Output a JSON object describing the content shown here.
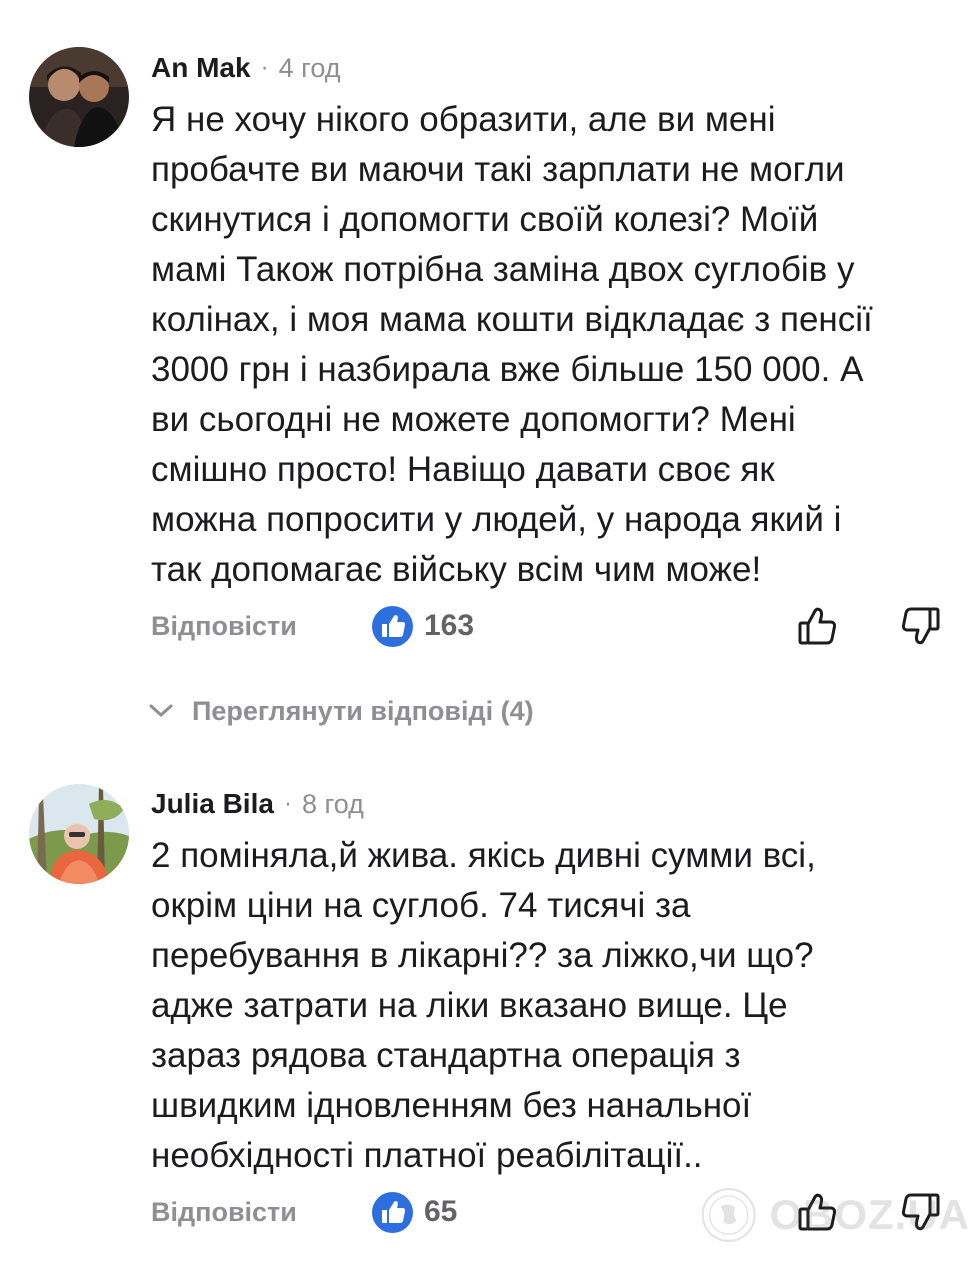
{
  "comments": [
    {
      "author": "An Mak",
      "separator": "·",
      "time": "4 год",
      "body_lines": [
        "Я не хочу нікого образити, але ви мені",
        "пробачте ви маючи такі зарплати не могли",
        "скинутися і допомогти своїй колезі? Моїй",
        "мамі Також потрібна заміна двох суглобів у",
        "колінах, і моя мама кошти відкладає з пенсії",
        "3000 грн і назбирала вже більше 150 000. А",
        "ви сьогодні не можете допомогти? Мені",
        "смішно просто! Навіщо давати своє як",
        "можна попросити у людей, у народа який і",
        "так допомагає війську всім чим може!"
      ],
      "reply_label": "Відповісти",
      "like_count": "163",
      "view_replies_label": "Переглянути відповіді (4)"
    },
    {
      "author": "Julia Bila",
      "separator": "·",
      "time": "8 год",
      "body_lines": [
        "2 поміняла,й жива. якісь дивні сумми всі,",
        "окрім ціни на суглоб. 74 тисячі за",
        "перебування в лікарні?? за ліжко,чи що?",
        "адже затрати на ліки вказано вище. Це",
        "зараз рядова стандартна операція з",
        "швидким ідновленням без нанальної",
        "необхідності платної реабілітації.."
      ],
      "reply_label": "Відповісти",
      "like_count": "65"
    }
  ],
  "watermark": {
    "text": "OBOZ.UA",
    "icon": "globe-logo-icon"
  },
  "icons": {
    "like_badge": "thumbs-up-filled-icon",
    "like_button": "thumbs-up-outline-icon",
    "dislike_button": "thumbs-down-outline-icon",
    "expand": "chevron-down-icon"
  },
  "colors": {
    "like_badge": "#2e6fe0",
    "secondary_text": "#8e8e93",
    "primary_text": "#1c1c1e"
  }
}
